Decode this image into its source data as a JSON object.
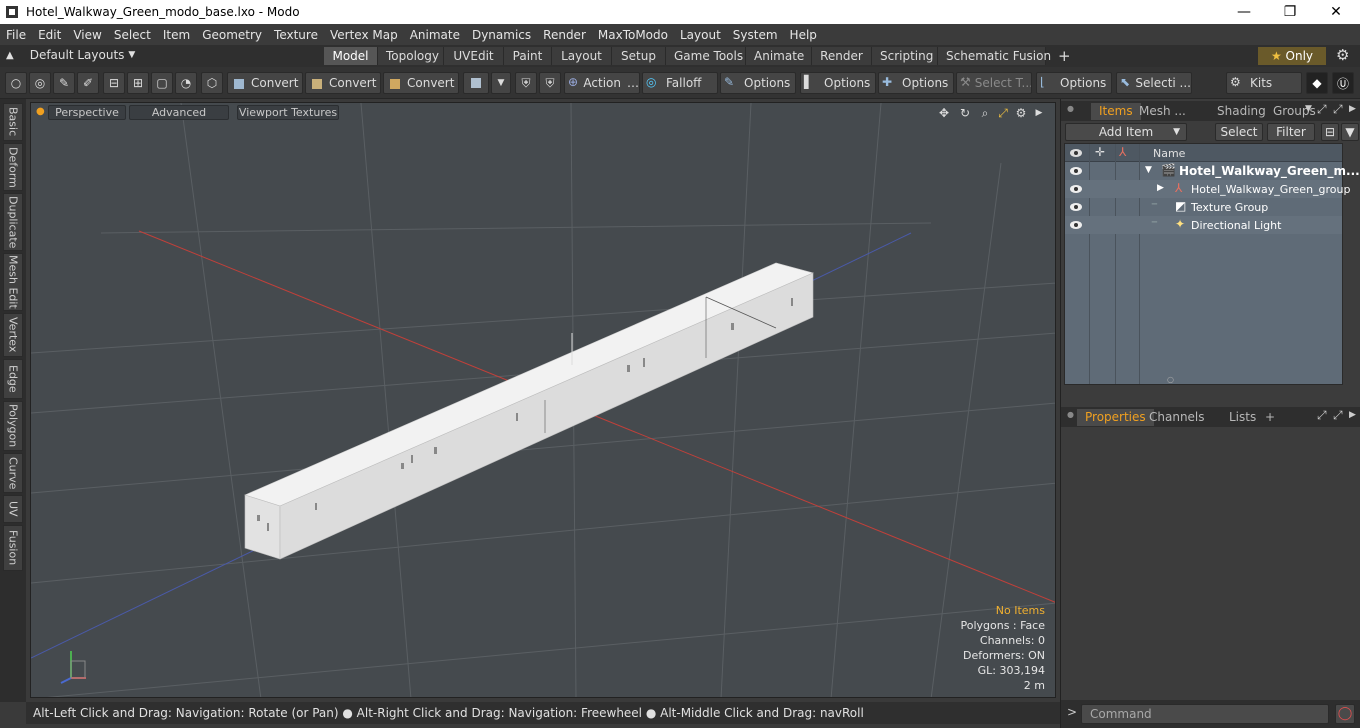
{
  "window": {
    "title": "Hotel_Walkway_Green_modo_base.lxo - Modo",
    "minimize": "—",
    "maximize": "❐",
    "close": "✕"
  },
  "menu": [
    "File",
    "Edit",
    "View",
    "Select",
    "Item",
    "Geometry",
    "Texture",
    "Vertex Map",
    "Animate",
    "Dynamics",
    "Render",
    "MaxToModo",
    "Layout",
    "System",
    "Help"
  ],
  "layouts": {
    "label": "Default Layouts",
    "tabs": [
      "Model",
      "Topology",
      "UVEdit",
      "Paint",
      "Layout",
      "Setup",
      "Game Tools",
      "Animate",
      "Render",
      "Scripting",
      "Schematic Fusion"
    ],
    "active_tab": "Model",
    "add": "+",
    "only": "Only"
  },
  "toolbar": {
    "convert1": "Convert",
    "convert2": "Convert",
    "convert3": "Convert",
    "action": "Action",
    "falloff": "Falloff",
    "options1": "Options",
    "options2": "Options",
    "options3": "Options",
    "select_t": "Select T...",
    "options4": "Options",
    "selecti": "Selecti ...",
    "kits": "Kits"
  },
  "left_tabs": [
    "Basic",
    "Deform",
    "Duplicate",
    "Mesh Edit",
    "Vertex",
    "Edge",
    "Polygon",
    "Curve",
    "UV",
    "Fusion"
  ],
  "viewport": {
    "view": "Perspective",
    "shading": "Advanced",
    "textures": "Viewport Textures",
    "info": {
      "items": "No Items",
      "polygons": "Polygons : Face",
      "channels": "Channels: 0",
      "deformers": "Deformers: ON",
      "gl": "GL: 303,194",
      "scale": "2 m"
    }
  },
  "status": "Alt-Left Click and Drag: Navigation: Rotate (or Pan) ● Alt-Right Click and Drag: Navigation: Freewheel ● Alt-Middle Click and Drag: navRoll",
  "items_panel": {
    "tabs": [
      "Items",
      "Mesh ...",
      "Shading",
      "Groups"
    ],
    "add_item": "Add Item",
    "select": "Select",
    "filter": "Filter",
    "column_name": "Name",
    "rows": [
      {
        "name": "Hotel_Walkway_Green_m...",
        "bold": true
      },
      {
        "name": "Hotel_Walkway_Green_group",
        "bold": false
      },
      {
        "name": "Texture Group",
        "bold": false
      },
      {
        "name": "Directional Light",
        "bold": false
      }
    ]
  },
  "properties_panel": {
    "tabs": [
      "Properties",
      "Channels",
      "Lists"
    ],
    "add": "+"
  },
  "command": {
    "prompt": ">",
    "placeholder": "Command"
  },
  "colors": {
    "accent": "#f0a020",
    "viewport_bg": "#454a4e",
    "x_axis": "#c0403a",
    "z_axis": "#4a5aa8"
  }
}
